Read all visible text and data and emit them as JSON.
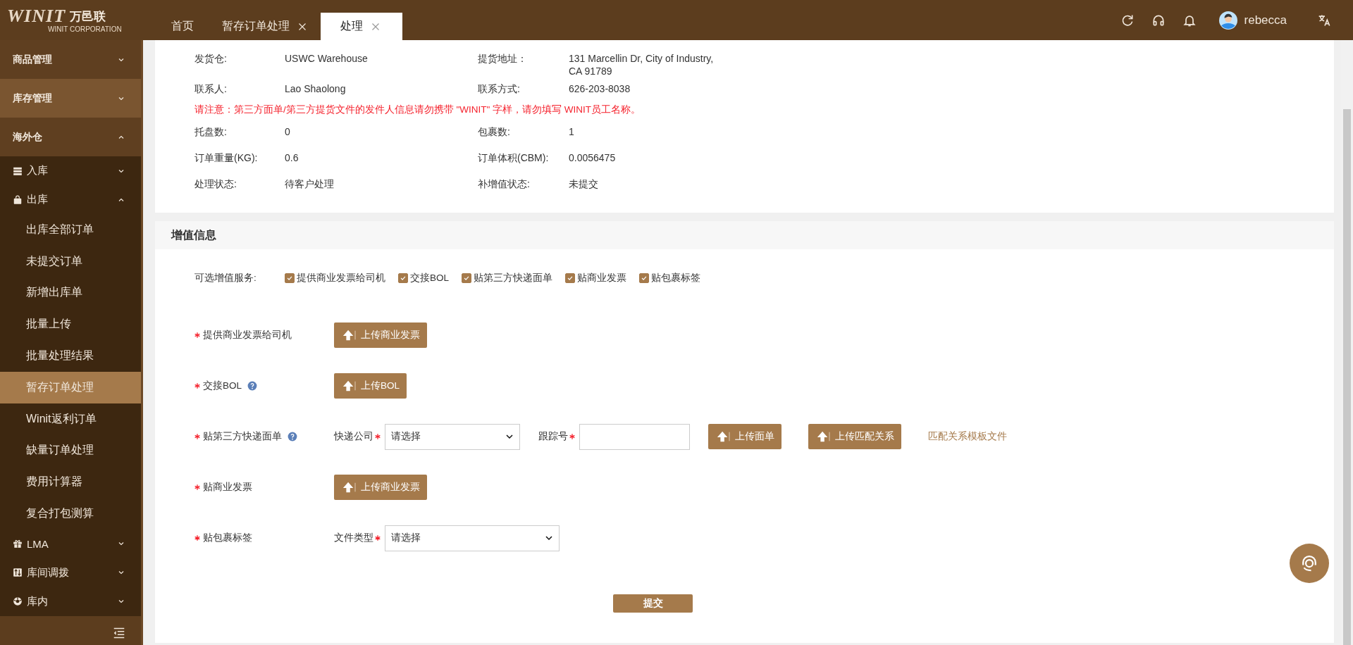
{
  "header": {
    "logo": {
      "brand": "WINIT",
      "brand_cn": "万邑联",
      "subtitle": "WINIT CORPORATION"
    },
    "tabs": [
      {
        "label": "首页",
        "closable": false,
        "selected": false
      },
      {
        "label": "暂存订单处理",
        "closable": true,
        "selected": false
      },
      {
        "label": "处理",
        "closable": true,
        "selected": true
      }
    ],
    "user": "rebecca"
  },
  "sidebar": {
    "items": [
      {
        "label": "商品管理",
        "expanded": false,
        "hovered": false
      },
      {
        "label": "库存管理",
        "expanded": false,
        "hovered": true
      },
      {
        "label": "海外仓",
        "expanded": true,
        "hovered": false,
        "children": [
          {
            "label": "入库",
            "expanded": false
          },
          {
            "label": "出库",
            "expanded": true,
            "children": [
              {
                "label": "出库全部订单",
                "selected": false
              },
              {
                "label": "未提交订单",
                "selected": false
              },
              {
                "label": "新增出库单",
                "selected": false
              },
              {
                "label": "批量上传",
                "selected": false
              },
              {
                "label": "批量处理结果",
                "selected": false
              },
              {
                "label": "暂存订单处理",
                "selected": true
              },
              {
                "label": "Winit返利订单",
                "selected": false
              },
              {
                "label": "缺量订单处理",
                "selected": false
              },
              {
                "label": "费用计算器",
                "selected": false
              },
              {
                "label": "复合打包测算",
                "selected": false
              }
            ]
          },
          {
            "label": "LMA",
            "expanded": false
          },
          {
            "label": "库间调拨",
            "expanded": false
          },
          {
            "label": "库内",
            "expanded": false
          }
        ]
      }
    ]
  },
  "info": {
    "rows": [
      {
        "kind": "fields",
        "fields": [
          {
            "label": "发货仓:",
            "value": "USWC Warehouse"
          },
          {
            "label": "提货地址：",
            "value": "131 Marcellin Dr, City of Industry, CA 91789"
          }
        ]
      },
      {
        "kind": "fields",
        "fields": [
          {
            "label": "联系人:",
            "value": "Lao Shaolong"
          },
          {
            "label": "联系方式:",
            "value": "626-203-8038"
          }
        ]
      },
      {
        "kind": "notice",
        "text": "请注意：第三方面单/第三方提货文件的发件人信息请勿携带 \"WINIT\" 字样，请勿填写 WINIT员工名称。"
      },
      {
        "kind": "fields",
        "fields": [
          {
            "label": "托盘数:",
            "value": "0"
          },
          {
            "label": "包裹数:",
            "value": "1"
          }
        ]
      },
      {
        "kind": "fields",
        "fields": [
          {
            "label": "订单重量(KG):",
            "value": "0.6"
          },
          {
            "label": "订单体积(CBM):",
            "value": "0.0056475"
          }
        ]
      },
      {
        "kind": "fields",
        "fields": [
          {
            "label": "处理状态:",
            "value": "待客户处理"
          },
          {
            "label": "补增值状态:",
            "value": "未提交"
          }
        ]
      }
    ]
  },
  "value_added": {
    "title": "增值信息",
    "services": {
      "label": "可选增值服务:",
      "options": [
        {
          "label": "提供商业发票给司机",
          "checked": true
        },
        {
          "label": "交接BOL",
          "checked": true
        },
        {
          "label": "贴第三方快递面单",
          "checked": true
        },
        {
          "label": "贴商业发票",
          "checked": true
        },
        {
          "label": "贴包裹标签",
          "checked": true
        }
      ]
    },
    "rows": [
      {
        "label": "提供商业发票给司机",
        "required": true,
        "help": false,
        "controls": [
          {
            "kind": "upload",
            "label": "上传商业发票"
          }
        ]
      },
      {
        "label": "交接BOL",
        "required": true,
        "help": true,
        "controls": [
          {
            "kind": "upload",
            "label": "上传BOL"
          }
        ]
      },
      {
        "label": "贴第三方快递面单",
        "required": true,
        "help": true,
        "controls": [
          {
            "kind": "select",
            "label": "快递公司",
            "required": true,
            "value": "请选择"
          },
          {
            "kind": "input",
            "label": "跟踪号",
            "required": true
          },
          {
            "kind": "upload",
            "label": "上传面单"
          },
          {
            "kind": "upload",
            "label": "上传匹配关系"
          },
          {
            "kind": "link",
            "label": "匹配关系模板文件"
          }
        ]
      },
      {
        "label": "贴商业发票",
        "required": true,
        "help": false,
        "controls": [
          {
            "kind": "upload",
            "label": "上传商业发票"
          }
        ]
      },
      {
        "label": "贴包裹标签",
        "required": true,
        "help": false,
        "controls": [
          {
            "kind": "select",
            "label": "文件类型",
            "required": true,
            "value": "请选择",
            "wide": true
          }
        ]
      }
    ],
    "submit": "提交"
  }
}
